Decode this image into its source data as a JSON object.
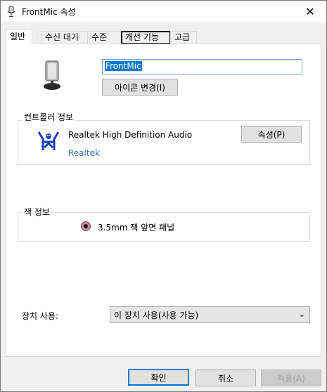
{
  "window": {
    "title": "FrontMic 속성",
    "close_glyph": "✕"
  },
  "tabs": [
    {
      "label": "일반"
    },
    {
      "label": "수신 대기"
    },
    {
      "label": "수준"
    },
    {
      "label": "개선 기능"
    },
    {
      "label": "고급"
    }
  ],
  "device": {
    "name": "FrontMic",
    "change_icon_label": "아이콘 변경(I)"
  },
  "controller": {
    "group_label": "컨트롤러 정보",
    "name": "Realtek High Definition Audio",
    "vendor": "Realtek",
    "properties_label": "속성(P)"
  },
  "jack": {
    "group_label": "잭 정보",
    "text": "3.5mm 잭 앞면 패널",
    "color": "#c98aa0"
  },
  "usage": {
    "label": "장치 사용:",
    "selected": "이 장치 사용(사용 가능)"
  },
  "footer": {
    "ok_label": "확인",
    "cancel_label": "취소",
    "apply_label": "적용(A)"
  },
  "colors": {
    "accent": "#0078d7",
    "link": "#3a6ea5"
  }
}
